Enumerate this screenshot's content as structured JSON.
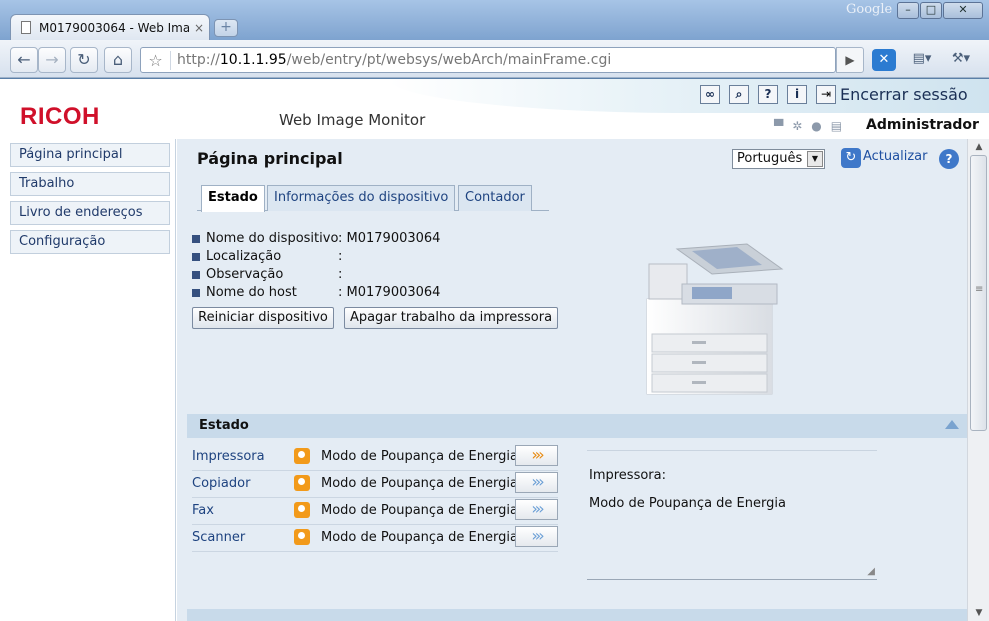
{
  "browser": {
    "tab_title": "M0179003064 - Web Ima...",
    "tab_close": "×",
    "newtab": "+",
    "brand": "Google",
    "url_prefix": "http://",
    "url_host": "10.1.1.95",
    "url_path": "/web/entry/pt/websys/webArch/mainFrame.cgi"
  },
  "header": {
    "logo": "RICOH",
    "app_title": "Web Image Monitor",
    "logout_label": "Encerrar sessão",
    "user": "Administrador"
  },
  "sidebar": {
    "items": [
      {
        "label": "Página principal"
      },
      {
        "label": "Trabalho"
      },
      {
        "label": "Livro de endereços"
      },
      {
        "label": "Configuração"
      }
    ]
  },
  "main": {
    "title": "Página principal",
    "language": "Português",
    "refresh_label": "Actualizar",
    "tabs": [
      {
        "label": "Estado"
      },
      {
        "label": "Informações do dispositivo"
      },
      {
        "label": "Contador"
      }
    ],
    "info": [
      {
        "label": "Nome do dispositivo",
        "value": ": M0179003064"
      },
      {
        "label": "Localização",
        "value": ":"
      },
      {
        "label": "Observação",
        "value": ":"
      },
      {
        "label": "Nome do host",
        "value": ": M0179003064"
      }
    ],
    "buttons": {
      "reset": "Reiniciar dispositivo",
      "clear_jobs": "Apagar trabalho da impressora"
    },
    "status_section": {
      "title": "Estado",
      "devices": [
        {
          "name": "Impressora",
          "status": "Modo de Poupança de Energia",
          "selected": true
        },
        {
          "name": "Copiador",
          "status": "Modo de Poupança de Energia",
          "selected": false
        },
        {
          "name": "Fax",
          "status": "Modo de Poupança de Energia",
          "selected": false
        },
        {
          "name": "Scanner",
          "status": "Modo de Poupança de Energia",
          "selected": false
        }
      ],
      "detail_line1": "Impressora:",
      "detail_line2": "Modo de Poupança de Energia"
    }
  },
  "colors": {
    "brand_red": "#d0102a",
    "link_blue": "#1e4380",
    "status_orange": "#f29a1a",
    "arrow_selected": "#e88a10",
    "arrow_normal": "#6b9fd6"
  }
}
